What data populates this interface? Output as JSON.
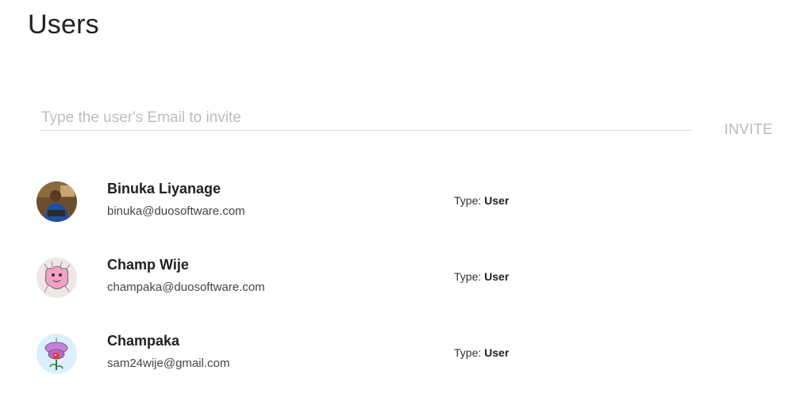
{
  "page": {
    "title": "Users"
  },
  "invite": {
    "placeholder": "Type the user's Email to invite",
    "button_label": "INVITE"
  },
  "users": [
    {
      "name": "Binuka Liyanage",
      "email": "binuka@duosoftware.com",
      "type_label": "Type:",
      "type_value": "User",
      "avatar": "photo-avatar"
    },
    {
      "name": "Champ Wije",
      "email": "champaka@duosoftware.com",
      "type_label": "Type:",
      "type_value": "User",
      "avatar": "pink-monster-avatar"
    },
    {
      "name": "Champaka",
      "email": "sam24wije@gmail.com",
      "type_label": "Type:",
      "type_value": "User",
      "avatar": "flower-monster-avatar"
    }
  ],
  "colors": {
    "text": "#212121",
    "muted": "#bdbdbd",
    "divider": "#dcdcdc"
  }
}
